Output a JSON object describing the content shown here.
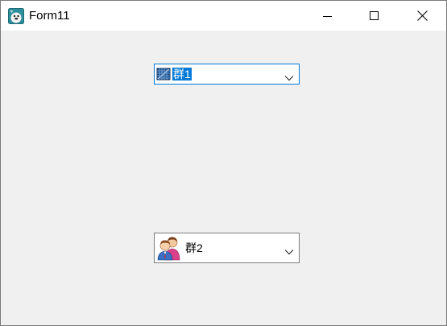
{
  "window": {
    "title": "Form11",
    "icon": "form-app-icon",
    "controls": {
      "minimize_icon": "minimize-icon",
      "maximize_icon": "maximize-icon",
      "close_icon": "close-icon"
    }
  },
  "combos": [
    {
      "selected_value": "群1",
      "item_icon": "network-grid-icon",
      "focused": true
    },
    {
      "selected_value": "群2",
      "item_icon": "users-group-icon",
      "focused": false
    }
  ],
  "colors": {
    "accent": "#0078d7",
    "window_bg": "#f0f0f0",
    "titlebar_bg": "#ffffff"
  }
}
